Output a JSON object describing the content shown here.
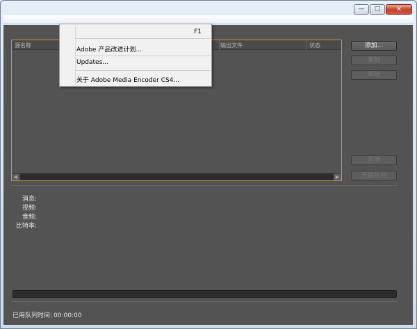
{
  "window": {
    "minimize": "—",
    "maximize": "□",
    "close": "✕"
  },
  "queue": {
    "columns": [
      "源名称",
      "输出文件",
      "状态"
    ]
  },
  "side_buttons": {
    "add": "添加...",
    "duplicate": "复制",
    "remove": "移除",
    "pause": "暂停",
    "start_queue": "开始队列"
  },
  "info": {
    "message": "消息:",
    "video": "视频:",
    "audio": "音频:",
    "bitrate": "比特率:"
  },
  "status": {
    "elapsed_label": "已用队列时间:",
    "elapsed_value": "00:00:00"
  },
  "menu": {
    "shortcut": "F1",
    "items": [
      "Adobe 产品改进计划...",
      "Updates...",
      "关于 Adobe Media Encoder CS4..."
    ]
  },
  "colors": {
    "panel_bg": "#535353",
    "queue_border": "#c59a3a",
    "menu_bg": "#f1f1f1"
  }
}
